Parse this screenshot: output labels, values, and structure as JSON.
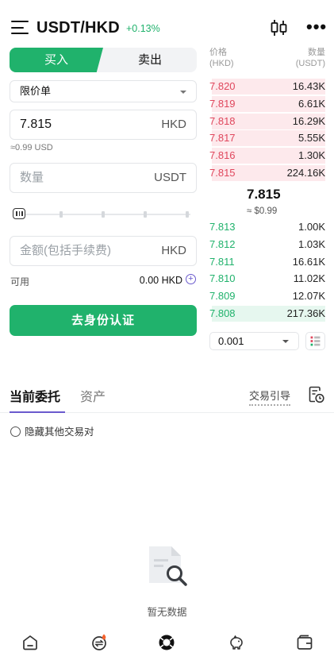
{
  "header": {
    "pair": "USDT/HKD",
    "change": "+0.13%",
    "more": "•••"
  },
  "trade_tabs": {
    "buy": "买入",
    "sell": "卖出"
  },
  "order_form": {
    "order_type": "限价单",
    "price_value": "7.815",
    "price_unit": "HKD",
    "price_approx": "≈0.99 USD",
    "qty_placeholder": "数量",
    "qty_unit": "USDT",
    "amount_placeholder": "金额(包括手续费)",
    "amount_unit": "HKD",
    "available_label": "可用",
    "available_value": "0.00 HKD",
    "cta": "去身份认证"
  },
  "orderbook": {
    "price_header": "价格",
    "price_unit": "(HKD)",
    "qty_header": "数量",
    "qty_unit": "(USDT)",
    "asks": [
      {
        "price": "7.820",
        "qty": "16.43K",
        "depth": 0.98
      },
      {
        "price": "7.819",
        "qty": "6.61K",
        "depth": 0.98
      },
      {
        "price": "7.818",
        "qty": "16.29K",
        "depth": 0.98
      },
      {
        "price": "7.817",
        "qty": "5.55K",
        "depth": 0.98
      },
      {
        "price": "7.816",
        "qty": "1.30K",
        "depth": 0.98
      },
      {
        "price": "7.815",
        "qty": "224.16K",
        "depth": 0.98
      }
    ],
    "mid_price": "7.815",
    "mid_usd": "≈ $0.99",
    "bids": [
      {
        "price": "7.813",
        "qty": "1.00K",
        "depth": 0.0
      },
      {
        "price": "7.812",
        "qty": "1.03K",
        "depth": 0.0
      },
      {
        "price": "7.811",
        "qty": "16.61K",
        "depth": 0.0
      },
      {
        "price": "7.810",
        "qty": "11.02K",
        "depth": 0.0
      },
      {
        "price": "7.809",
        "qty": "12.07K",
        "depth": 0.0
      },
      {
        "price": "7.808",
        "qty": "217.36K",
        "depth": 0.98
      }
    ],
    "depth_precision": "0.001"
  },
  "orders_section": {
    "tab_open": "当前委托",
    "tab_assets": "资产",
    "guide": "交易引导",
    "hide_others": "隐藏其他交易对",
    "empty": "暂无数据"
  },
  "colors": {
    "buy": "#20b26c",
    "sell": "#e0475d",
    "accent": "#6a5acd",
    "badge": "#f5622d"
  },
  "icons": {
    "menu": "menu-icon",
    "chart": "candlestick-icon",
    "layout": "orderbook-layout-icon",
    "history": "order-history-icon",
    "empty": "empty-document-search-icon",
    "nav": [
      "home-icon",
      "exchange-icon",
      "trade-icon",
      "earn-piggy-icon",
      "wallet-icon"
    ]
  }
}
